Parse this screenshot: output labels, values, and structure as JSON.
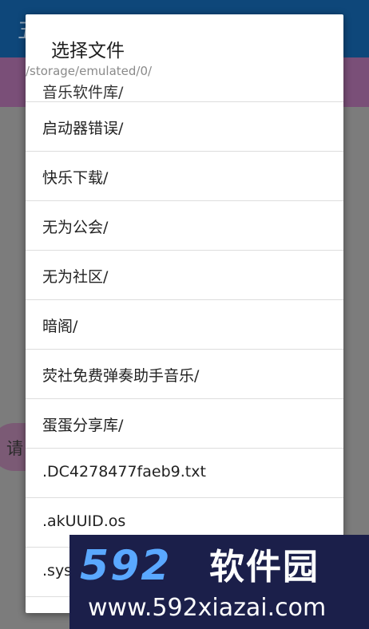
{
  "background": {
    "toolbar_title": "五",
    "chip_label": "请"
  },
  "dialog": {
    "title": "选择文件",
    "path": "/storage/emulated/0/",
    "items": [
      {
        "name": "音乐软件库/"
      },
      {
        "name": "启动器错误/"
      },
      {
        "name": "快乐下载/"
      },
      {
        "name": "无为公会/"
      },
      {
        "name": "无为社区/"
      },
      {
        "name": "暗阁/"
      },
      {
        "name": "荧社免费弹奏助手音乐/"
      },
      {
        "name": "蛋蛋分享库/"
      },
      {
        "name": ".DC4278477faeb9.txt"
      },
      {
        "name": ".akUUID.os"
      },
      {
        "name": ".sys"
      }
    ]
  },
  "watermark": {
    "logo_number": "592",
    "logo_text": "软件园",
    "url": "www.592xiazai.com"
  },
  "colors": {
    "toolbar": "#0e477a",
    "accent_band": "#7a4f78",
    "scrim": "#7c7c7c",
    "watermark_bg": "#1b1f4a",
    "watermark_logo": "#5aa8ff"
  }
}
